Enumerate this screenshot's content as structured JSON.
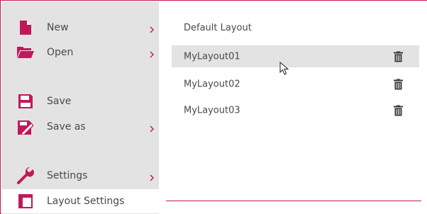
{
  "colors": {
    "accent": "#c2185b",
    "sidebar_bg": "#e3e3e3",
    "text": "#4a4a4a",
    "icon_dark": "#111111"
  },
  "menu": {
    "items": [
      {
        "label": "New",
        "icon": "new-document-icon",
        "has_submenu": true
      },
      {
        "label": "Open",
        "icon": "folder-open-icon",
        "has_submenu": true
      },
      {
        "label": "Save",
        "icon": "floppy-disk-icon",
        "has_submenu": false
      },
      {
        "label": "Save as",
        "icon": "save-as-icon",
        "has_submenu": true
      },
      {
        "label": "Settings",
        "icon": "wrench-icon",
        "has_submenu": true
      },
      {
        "label": "Layout Settings",
        "icon": "layout-icon",
        "has_submenu": false,
        "active": true
      }
    ]
  },
  "layouts": {
    "default_label": "Default Layout",
    "items": [
      {
        "name": "MyLayout01",
        "hovered": true
      },
      {
        "name": "MyLayout02",
        "hovered": false
      },
      {
        "name": "MyLayout03",
        "hovered": false
      }
    ]
  }
}
